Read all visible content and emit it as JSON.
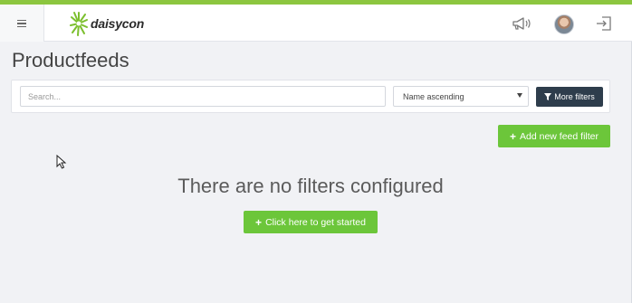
{
  "header": {
    "menu_icon": "hamburger-icon",
    "logo_text": "daisycon",
    "icons": [
      "megaphone-icon",
      "avatar",
      "logout-icon"
    ]
  },
  "page": {
    "title": "Productfeeds"
  },
  "filters": {
    "search_placeholder": "Search...",
    "sort_selected": "Name ascending",
    "more_filters_label": "More filters"
  },
  "actions": {
    "add_filter_label": "Add new feed filter"
  },
  "empty_state": {
    "message": "There are no filters configured",
    "cta_label": "Click here to get started"
  },
  "colors": {
    "accent_green": "#6cc63a",
    "top_bar": "#8cc63f",
    "dark_button": "#2e3d4c"
  }
}
